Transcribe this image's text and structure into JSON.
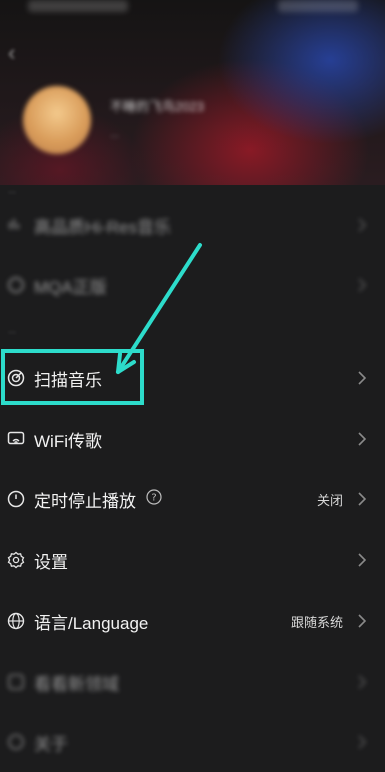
{
  "profile": {
    "username": "不睡的飞鸟2023",
    "subtitle": "..."
  },
  "sections": {
    "top_label": "...",
    "mid_label": "..."
  },
  "menu": {
    "hires": {
      "label": "高品质Hi-Res音乐",
      "icon": "hires-icon"
    },
    "mqa": {
      "label": "MQA正版",
      "icon": "mqa-icon"
    },
    "scan": {
      "label": "扫描音乐",
      "icon": "radar-scan-icon"
    },
    "wifi": {
      "label": "WiFi传歌",
      "icon": "wifi-transfer-icon"
    },
    "timer": {
      "label": "定时停止播放",
      "value": "关闭",
      "icon": "clock-icon"
    },
    "settings": {
      "label": "设置",
      "icon": "gear-icon"
    },
    "language": {
      "label": "语言/Language",
      "value": "跟随系统",
      "icon": "globe-icon"
    },
    "feedback": {
      "label": "看看新领域",
      "icon": "feedback-icon"
    },
    "about": {
      "label": "关于",
      "icon": "about-icon"
    }
  },
  "annotation": {
    "highlight_color": "#2ddccb",
    "target": "scan"
  }
}
